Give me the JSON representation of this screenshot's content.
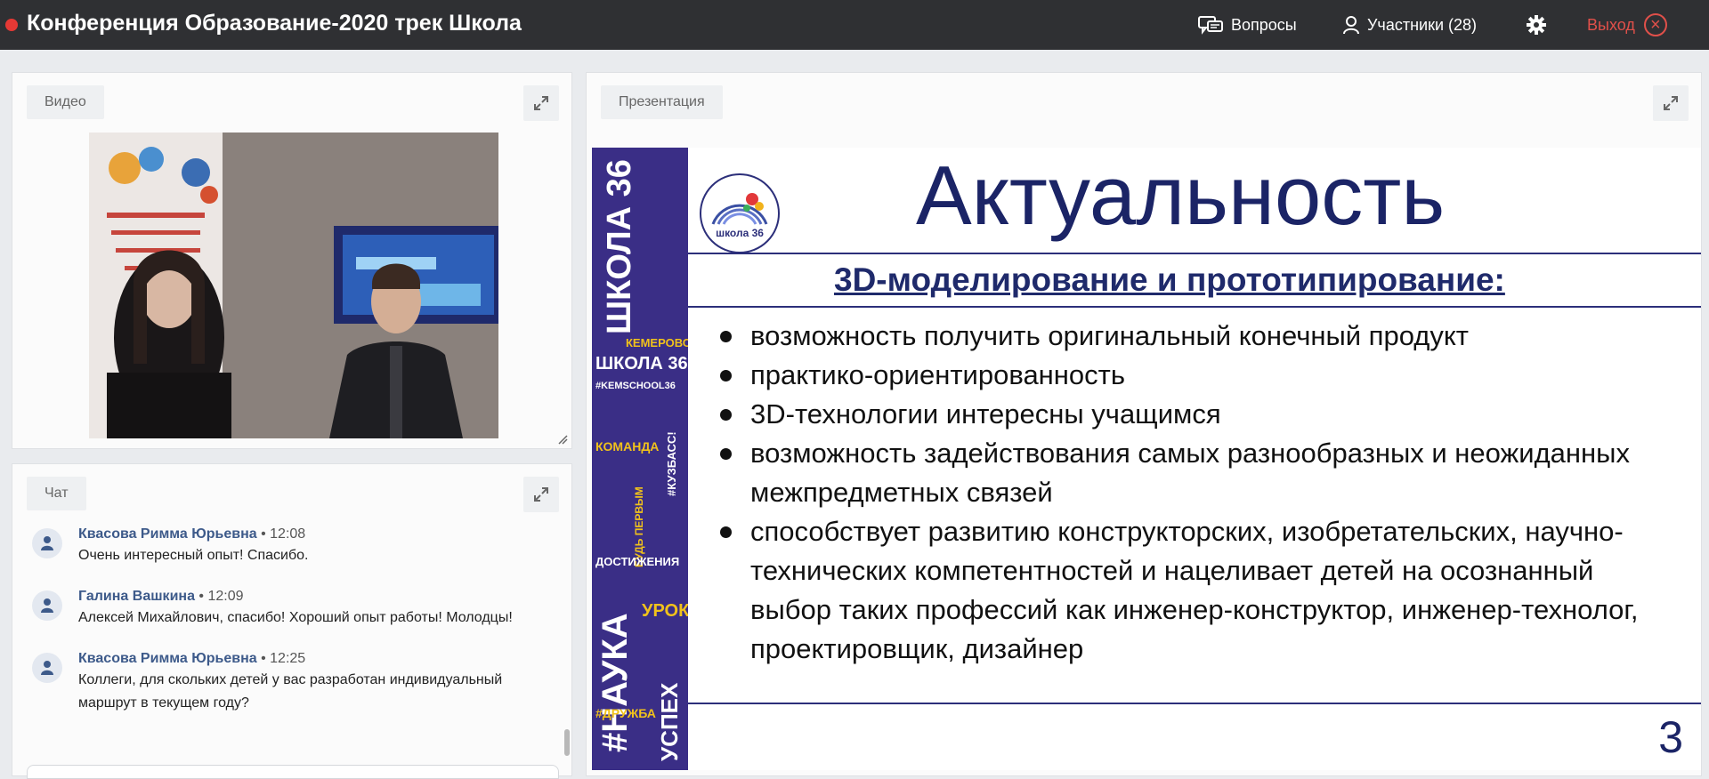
{
  "header": {
    "title": "Конференция Образование-2020 трек Школа",
    "questions_label": "Вопросы",
    "participants_label": "Участники (28)",
    "exit_label": "Выход",
    "exit_symbol": "×"
  },
  "video": {
    "tab_label": "Видео"
  },
  "chat": {
    "tab_label": "Чат",
    "messages": [
      {
        "author": "Квасова Римма Юрьевна",
        "time": " • 12:08",
        "text": "Очень интересный опыт! Спасибо."
      },
      {
        "author": "Галина Вашкина",
        "time": " • 12:09",
        "text": "Алексей Михайлович, спасибо! Хороший опыт работы! Молодцы!"
      },
      {
        "author": "Квасова Римма Юрьевна",
        "time": " • 12:25",
        "text": "Коллеги, для скольких детей у вас разработан индивидуальный маршрут в текущем году?"
      }
    ]
  },
  "presentation": {
    "tab_label": "Презентация",
    "slide": {
      "title": "Актуальность",
      "subtitle": "3D-моделирование и прототипирование:",
      "bullets": [
        "возможность получить оригинальный конечный продукт",
        "практико-ориентированность",
        "3D-технологии интересны учащимся",
        "возможность задействования самых разнообразных и неожиданных межпредметных связей",
        "способствует развитию конструкторских, изобретательских, научно-технических компетентностей и нацеливает детей на осознанный выбор таких профессий как инженер-конструктор, инженер-технолог, проектировщик, дизайнер"
      ],
      "page_number": "3",
      "sidebar": {
        "school_big": "ШКОЛА 36",
        "city": "КЕМЕРОВО",
        "school_small": "ШКОЛА 36",
        "hashtag": "#KEMSCHOOL36",
        "team": "КОМАНДА",
        "kuzbass": "#КУЗБАСС!",
        "be_first": "БУДЬ ПЕРВЫМ",
        "achievements": "ДОСТИЖЕНИЯ",
        "nauka": "#НАУКА",
        "urok": "УРОК",
        "uspekh": "УСПЕХ",
        "druzhba": "#ДРУЖБА"
      }
    }
  },
  "colors": {
    "topbar": "#2f3033",
    "exit": "#e0504a",
    "chat_author": "#3d5a8a",
    "slide_sidebar": "#3a2e86",
    "slide_title": "#1b2466"
  },
  "icons": [
    "questions-icon",
    "user-icon",
    "gear-icon",
    "close-icon",
    "expand-icon",
    "avatar-icon"
  ]
}
